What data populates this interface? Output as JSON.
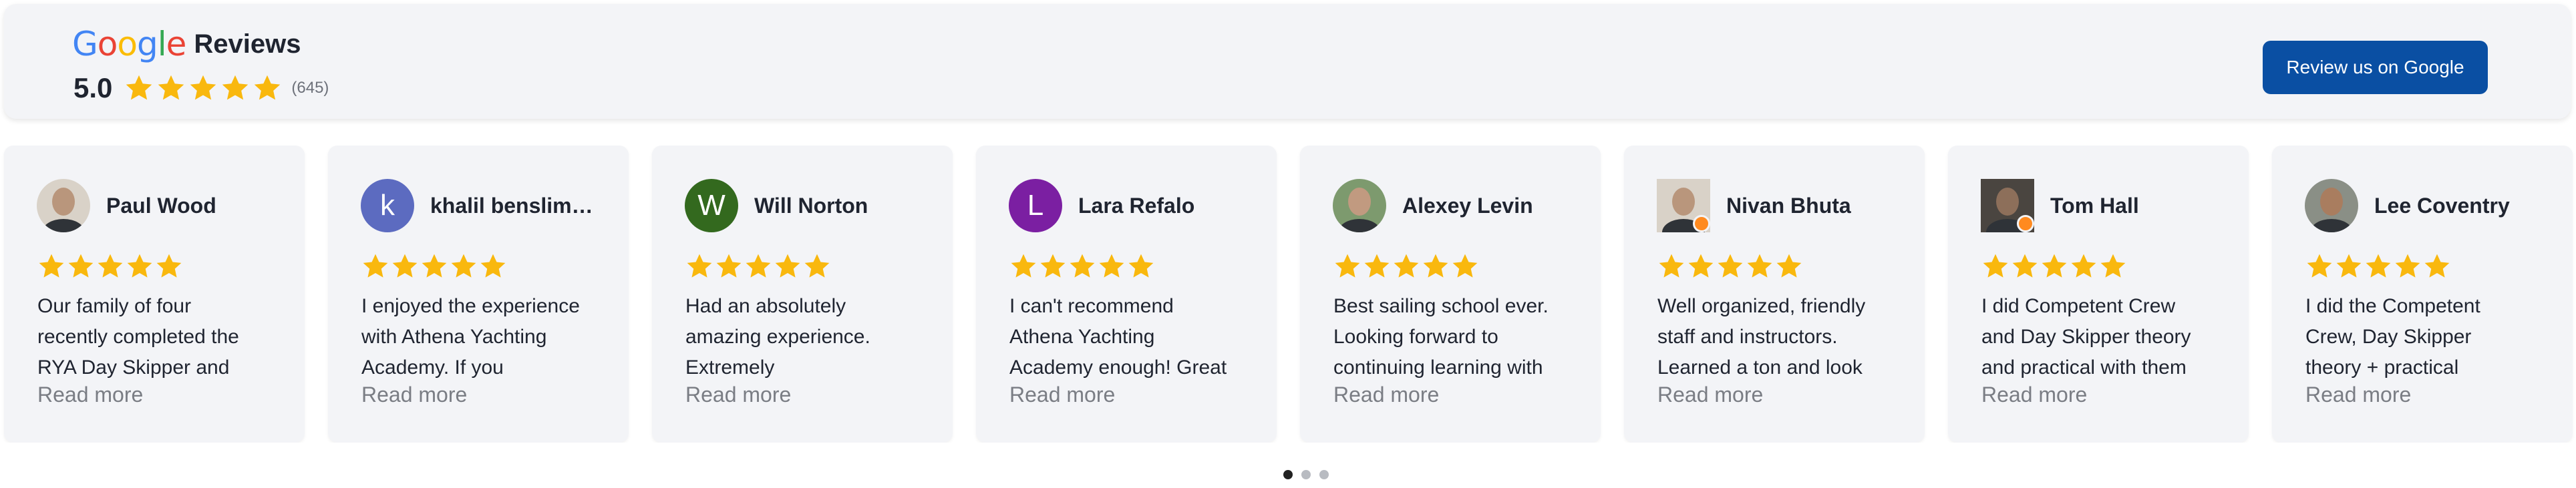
{
  "header": {
    "google_letters": [
      {
        "char": "G",
        "color": "#4285F4"
      },
      {
        "char": "o",
        "color": "#EA4335"
      },
      {
        "char": "o",
        "color": "#FBBC05"
      },
      {
        "char": "g",
        "color": "#4285F4"
      },
      {
        "char": "l",
        "color": "#34A853"
      },
      {
        "char": "e",
        "color": "#EA4335"
      }
    ],
    "title": "Reviews",
    "rating": "5.0",
    "stars": 5,
    "count": "(645)",
    "review_button_label": "Review us on Google"
  },
  "colors": {
    "star": "#F9B80E",
    "button": "#0A4FA3",
    "card_bg": "#F3F4F7"
  },
  "reviews": [
    {
      "name": "Paul Wood",
      "avatar_type": "photo",
      "icon": "user-photo-icon",
      "rating": 5,
      "text": "Our family of four recently completed the RYA Day Skipper and",
      "read_more": "Read more"
    },
    {
      "name": "khalil benslim…",
      "avatar_type": "letter",
      "letter": "k",
      "avatar_color": "#5C6BC0",
      "rating": 5,
      "text": "I enjoyed the experience with Athena Yachting Academy. If you",
      "read_more": "Read more"
    },
    {
      "name": "Will Norton",
      "avatar_type": "letter",
      "letter": "W",
      "avatar_color": "#33691E",
      "rating": 5,
      "text": "Had an absolutely amazing experience. Extremely",
      "read_more": "Read more"
    },
    {
      "name": "Lara Refalo",
      "avatar_type": "letter",
      "letter": "L",
      "avatar_color": "#7B1FA2",
      "rating": 5,
      "text": "I can't recommend Athena Yachting Academy enough! Great",
      "read_more": "Read more"
    },
    {
      "name": "Alexey Levin",
      "avatar_type": "photo",
      "icon": "user-photo-icon",
      "rating": 5,
      "text": "Best sailing school ever. Looking forward to continuing learning with",
      "read_more": "Read more"
    },
    {
      "name": "Nivan Bhuta",
      "avatar_type": "photo",
      "icon": "user-photo-icon",
      "local_guide": true,
      "rating": 5,
      "text": "Well organized, friendly staff and instructors. Learned a ton and look",
      "read_more": "Read more"
    },
    {
      "name": "Tom Hall",
      "avatar_type": "photo",
      "icon": "user-photo-icon",
      "local_guide": true,
      "rating": 5,
      "text": "I did Competent Crew and Day Skipper theory and practical with them",
      "read_more": "Read more"
    },
    {
      "name": "Lee Coventry",
      "avatar_type": "photo",
      "icon": "user-photo-icon",
      "rating": 5,
      "text": "I did the Competent Crew, Day Skipper theory + practical",
      "read_more": "Read more"
    }
  ],
  "pagination": {
    "pages": 3,
    "active": 0
  }
}
